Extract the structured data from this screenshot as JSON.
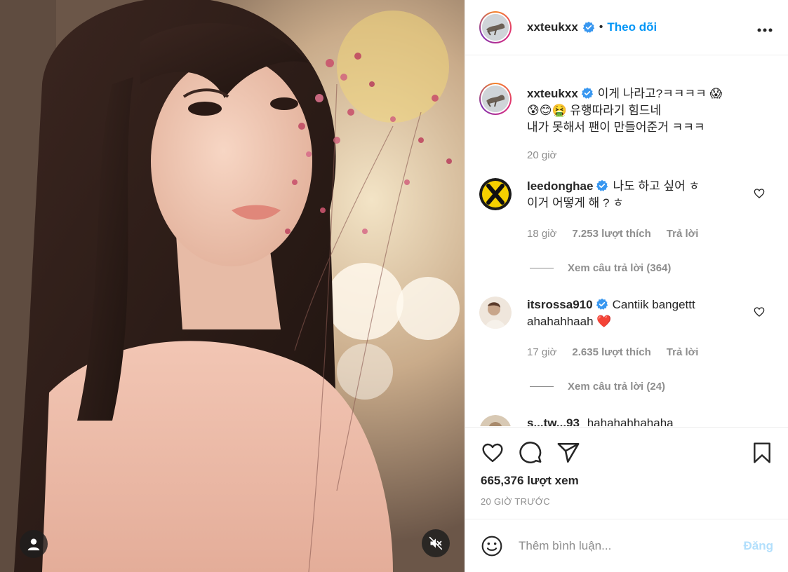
{
  "post": {
    "username": "xxteukxx",
    "follow_label": "Theo dõi",
    "more_label": "•••",
    "separator": "•",
    "colors": {
      "accent": "#0095f6",
      "verified": "#3897f0",
      "muted": "#8e8e8e",
      "heart": "#ed4956"
    }
  },
  "caption": {
    "username": "xxteukxx",
    "text_line1": "이게 나라고?ㅋㅋㅋㅋ 😱",
    "text_line2": "😰😊🤮 유행따라기 힘드네",
    "text_line3": "내가 못해서 팬이 만들어준거 ㅋㅋㅋ",
    "time": "20 giờ"
  },
  "comments": [
    {
      "username": "leedonghae",
      "text_line1": "나도 하고 싶어 ㅎ",
      "text_line2": "이거 어떻게 해 ? ㅎ",
      "time": "18 giờ",
      "likes": "7.253 lượt thích",
      "reply_label": "Trả lời",
      "view_replies": "Xem câu trả lời (364)"
    },
    {
      "username": "itsrossa910",
      "text_line1": "Cantiik bangettt",
      "text_line2": "ahahahhaah ❤️",
      "time": "17 giờ",
      "likes": "2.635 lượt thích",
      "reply_label": "Trả lời",
      "view_replies": "Xem câu trả lời (24)"
    },
    {
      "username": "s...tw...93",
      "text_line1": "hahahahhahaha"
    }
  ],
  "actions": {
    "icons": [
      "heart-icon",
      "comment-icon",
      "share-icon",
      "bookmark-icon"
    ],
    "views": "665,376 lượt xem",
    "time_ago": "20 GIỜ TRƯỚC"
  },
  "add_comment": {
    "placeholder": "Thêm bình luận...",
    "post_label": "Đăng"
  }
}
